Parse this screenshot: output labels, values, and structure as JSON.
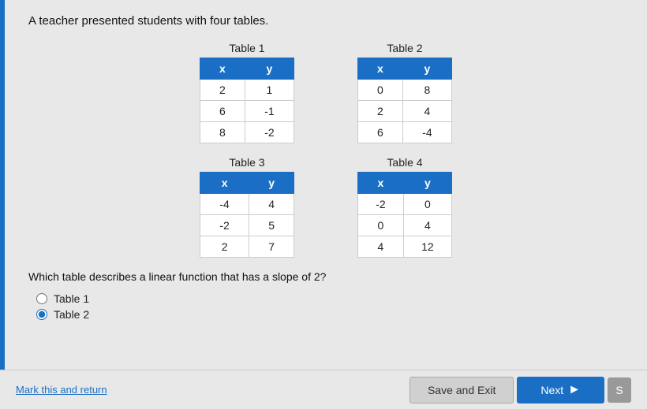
{
  "question": {
    "text": "A teacher presented students with four tables."
  },
  "table1": {
    "title": "Table 1",
    "headers": [
      "x",
      "y"
    ],
    "rows": [
      [
        "2",
        "1"
      ],
      [
        "6",
        "-1"
      ],
      [
        "8",
        "-2"
      ]
    ]
  },
  "table2": {
    "title": "Table 2",
    "headers": [
      "x",
      "y"
    ],
    "rows": [
      [
        "0",
        "8"
      ],
      [
        "2",
        "4"
      ],
      [
        "6",
        "-4"
      ]
    ]
  },
  "table3": {
    "title": "Table 3",
    "headers": [
      "x",
      "y"
    ],
    "rows": [
      [
        "-4",
        "4"
      ],
      [
        "-2",
        "5"
      ],
      [
        "2",
        "7"
      ]
    ]
  },
  "table4": {
    "title": "Table 4",
    "headers": [
      "x",
      "y"
    ],
    "rows": [
      [
        "-2",
        "0"
      ],
      [
        "0",
        "4"
      ],
      [
        "4",
        "12"
      ]
    ]
  },
  "prompt": "Which table describes a linear function that has a slope of 2?",
  "options": [
    {
      "label": "Table 1",
      "value": "table1",
      "selected": true
    },
    {
      "label": "Table 2",
      "value": "table2",
      "selected": true
    }
  ],
  "buttons": {
    "save": "Save and Exit",
    "next": "Next",
    "mark_link": "Mark this and return"
  }
}
